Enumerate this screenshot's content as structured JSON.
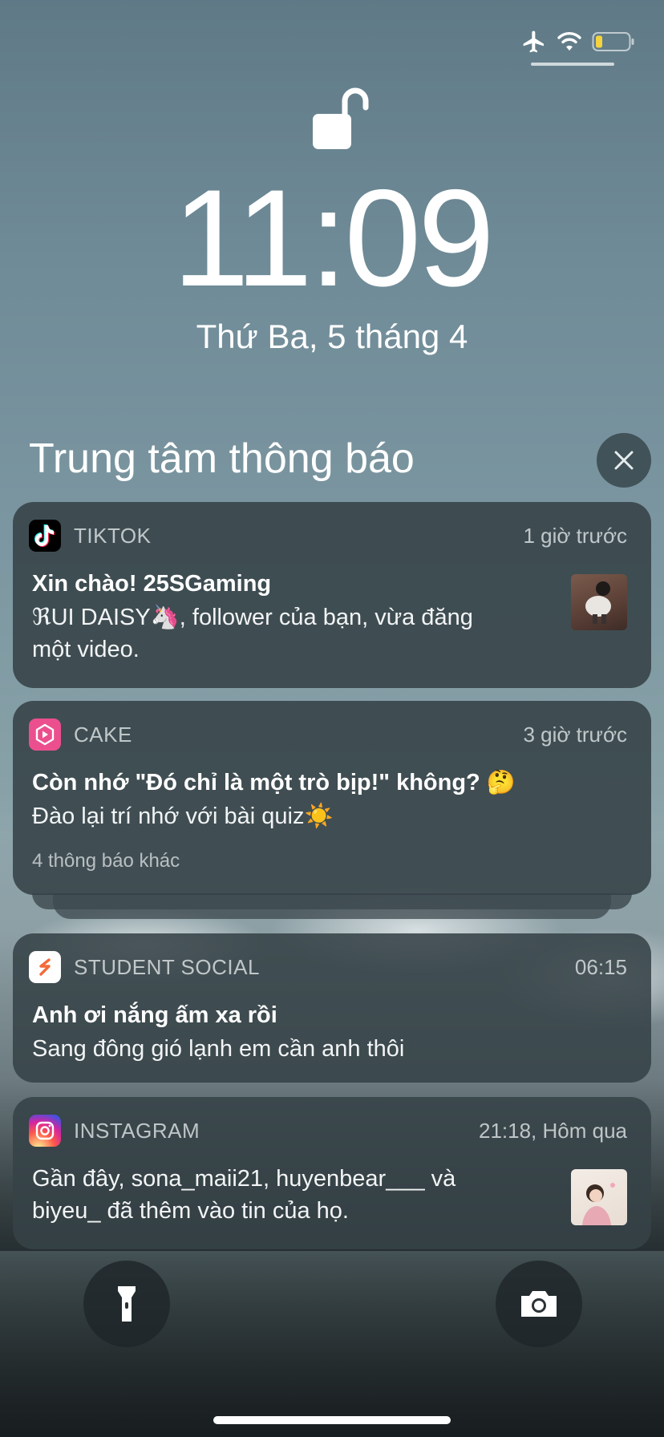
{
  "colors": {
    "card_bg": "#364247",
    "tiktok": "#000000",
    "cake": "#ec4f8e",
    "student_social": "#f26b3a",
    "instagram": "#d6249f"
  },
  "status_icons": [
    "airplane-icon",
    "wifi-icon",
    "battery-icon"
  ],
  "lock": {
    "icon": "unlocked-padlock-icon",
    "time": "11:09",
    "date": "Thứ Ba, 5 tháng 4"
  },
  "notification_center": {
    "title": "Trung tâm thông báo",
    "close_icon": "close-icon"
  },
  "notifications": [
    {
      "app": "TIKTOK",
      "time": "1 giờ trước",
      "title": "Xin chào! 25SGaming",
      "body_line1": "ℜUI DAISY🦄, follower của bạn, vừa đăng",
      "body_line2": "một video."
    },
    {
      "app": "CAKE",
      "time": "3 giờ trước",
      "title": "Còn nhớ \"Đó chỉ là một trò bịp!\" không? 🤔",
      "body_line1": "Đào lại trí nhớ với bài quiz☀️",
      "more": "4 thông báo khác"
    },
    {
      "app": "STUDENT SOCIAL",
      "time": "06:15",
      "title": "Anh ơi nắng ấm xa rồi",
      "body_line1": "Sang đông gió lạnh em cần anh thôi"
    },
    {
      "app": "INSTAGRAM",
      "time": "21:18, Hôm qua",
      "body_line1": "Gần đây, sona_maii21, huyenbear___ và",
      "body_line2": "biyeu_ đã thêm vào tin của họ."
    }
  ],
  "bottom_controls": {
    "left_icon": "flashlight-icon",
    "right_icon": "camera-icon"
  }
}
